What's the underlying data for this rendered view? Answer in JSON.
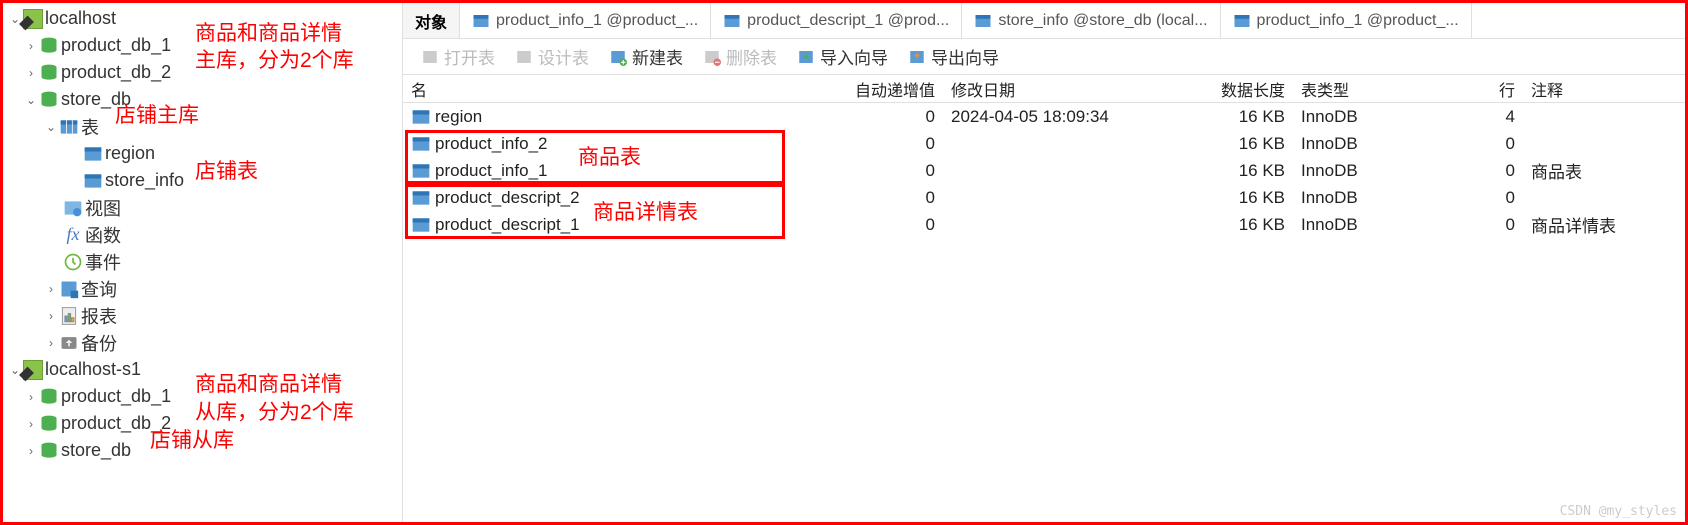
{
  "sidebar": {
    "conn1": "localhost",
    "conn2": "localhost-s1",
    "db1": "product_db_1",
    "db2": "product_db_2",
    "db3": "store_db",
    "db1b": "product_db_1",
    "db2b": "product_db_2",
    "db3b": "store_db",
    "tables_group": "表",
    "region": "region",
    "store_info": "store_info",
    "views": "视图",
    "funcs": "函数",
    "events": "事件",
    "queries": "查询",
    "reports": "报表",
    "backups": "备份"
  },
  "annotations": {
    "l1": "商品和商品详情",
    "l2": "主库，分为2个库",
    "l3": "店铺主库",
    "l4": "店铺表",
    "l5": "商品和商品详情",
    "l6": "从库，分为2个库",
    "l7": "店铺从库",
    "r1": "商品表",
    "r2": "商品详情表"
  },
  "tabs": {
    "t0": "对象",
    "t1": "product_info_1 @product_...",
    "t2": "product_descript_1 @prod...",
    "t3": "store_info @store_db (local...",
    "t4": "product_info_1 @product_..."
  },
  "toolbar": {
    "open": "打开表",
    "design": "设计表",
    "new": "新建表",
    "delete": "删除表",
    "import": "导入向导",
    "export": "导出向导"
  },
  "cols": {
    "name": "名",
    "auto": "自动递增值",
    "date": "修改日期",
    "size": "数据长度",
    "type": "表类型",
    "rows": "行",
    "comment": "注释"
  },
  "rows": [
    {
      "name": "region",
      "auto": "0",
      "date": "2024-04-05 18:09:34",
      "size": "16 KB",
      "type": "InnoDB",
      "rows": "4",
      "comment": ""
    },
    {
      "name": "product_info_2",
      "auto": "0",
      "date": "",
      "size": "16 KB",
      "type": "InnoDB",
      "rows": "0",
      "comment": ""
    },
    {
      "name": "product_info_1",
      "auto": "0",
      "date": "",
      "size": "16 KB",
      "type": "InnoDB",
      "rows": "0",
      "comment": "商品表"
    },
    {
      "name": "product_descript_2",
      "auto": "0",
      "date": "",
      "size": "16 KB",
      "type": "InnoDB",
      "rows": "0",
      "comment": ""
    },
    {
      "name": "product_descript_1",
      "auto": "0",
      "date": "",
      "size": "16 KB",
      "type": "InnoDB",
      "rows": "0",
      "comment": "商品详情表"
    }
  ],
  "watermark": "CSDN @my_styles"
}
